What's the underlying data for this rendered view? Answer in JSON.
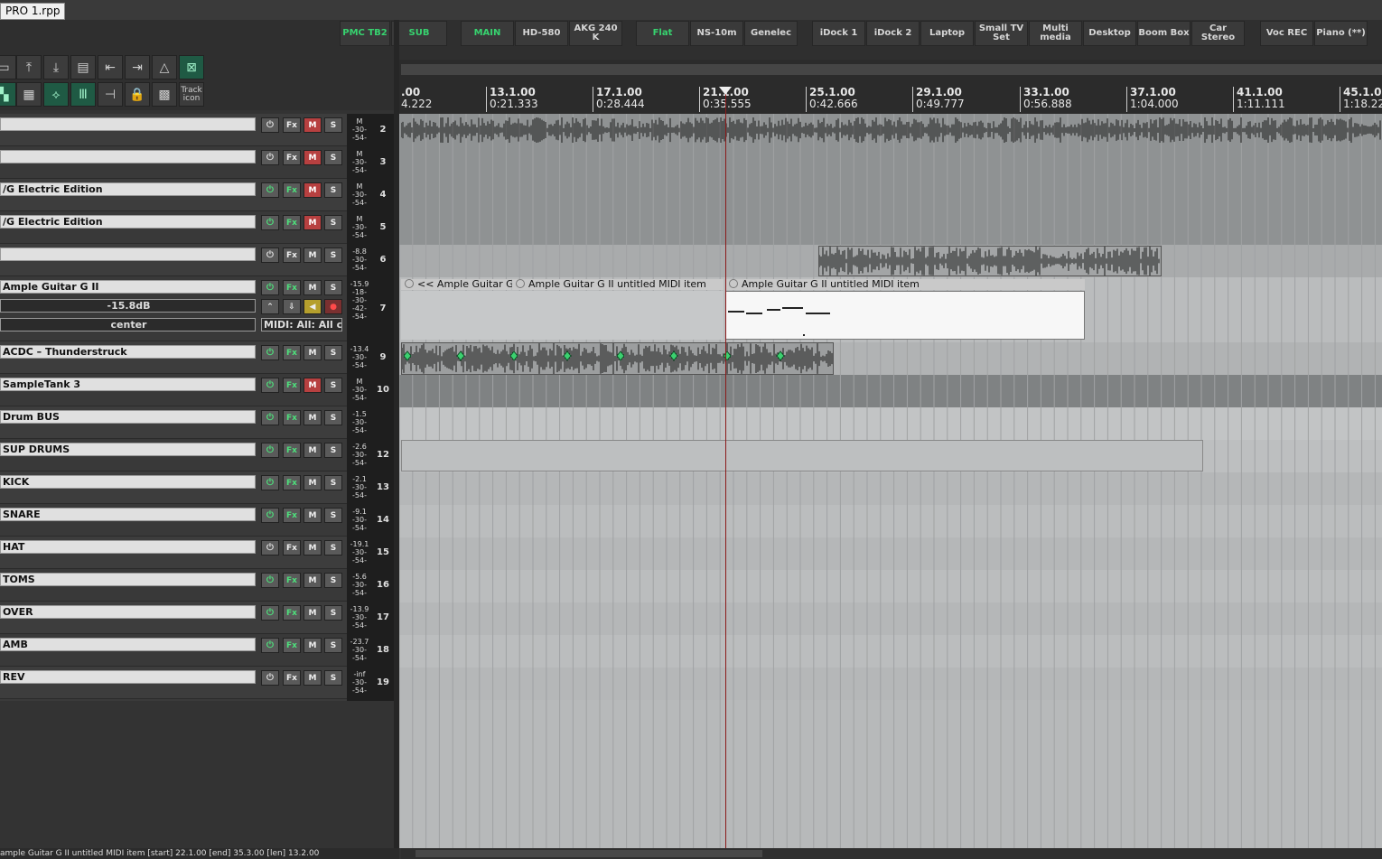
{
  "window": {
    "file_tab": "PRO 1.rpp"
  },
  "view_buttons": [
    {
      "label": "PMC TB2",
      "active": true
    },
    {
      "label": "SUB",
      "active": true
    },
    {
      "label": "MAIN",
      "active": true
    },
    {
      "label": "HD-580",
      "active": false
    },
    {
      "label": "AKG 240 K",
      "active": false
    },
    {
      "label": "Flat",
      "active": true
    },
    {
      "label": "NS-10m",
      "active": false
    },
    {
      "label": "Genelec",
      "active": false
    },
    {
      "label": "iDock 1",
      "active": false
    },
    {
      "label": "iDock 2",
      "active": false
    },
    {
      "label": "Laptop",
      "active": false
    },
    {
      "label": "Small TV Set",
      "active": false
    },
    {
      "label": "Multi media",
      "active": false
    },
    {
      "label": "Desktop",
      "active": false
    },
    {
      "label": "Boom Box",
      "active": false
    },
    {
      "label": "Car Stereo",
      "active": false
    },
    {
      "label": "Voc REC",
      "active": false
    },
    {
      "label": "Piano (**)",
      "active": false
    }
  ],
  "toolbar": {
    "track_icon_label": "Track icon"
  },
  "ruler": [
    {
      "bar": ".00",
      "time": "4.222"
    },
    {
      "bar": "13.1.00",
      "time": "0:21.333"
    },
    {
      "bar": "17.1.00",
      "time": "0:28.444"
    },
    {
      "bar": "21.1.00",
      "time": "0:35.555"
    },
    {
      "bar": "25.1.00",
      "time": "0:42.666"
    },
    {
      "bar": "29.1.00",
      "time": "0:49.777"
    },
    {
      "bar": "33.1.00",
      "time": "0:56.888"
    },
    {
      "bar": "37.1.00",
      "time": "1:04.000"
    },
    {
      "bar": "41.1.00",
      "time": "1:11.111"
    },
    {
      "bar": "45.1.00",
      "time": "1:18.22"
    }
  ],
  "track_buttons": {
    "fx": "Fx",
    "mute": "M",
    "solo": "S"
  },
  "tracks": [
    {
      "num": "2",
      "name": "",
      "meter": [
        "M",
        "-30-",
        "-54-"
      ],
      "fx_on": false,
      "mute_on": true,
      "power_on": false
    },
    {
      "num": "3",
      "name": "",
      "meter": [
        "M",
        "-30-",
        "-54-"
      ],
      "fx_on": false,
      "mute_on": true,
      "power_on": false
    },
    {
      "num": "4",
      "name": "/G Electric Edition",
      "meter": [
        "M",
        "-30-",
        "-54-"
      ],
      "fx_on": true,
      "mute_on": true,
      "power_on": true
    },
    {
      "num": "5",
      "name": "/G Electric Edition",
      "meter": [
        "M",
        "-30-",
        "-54-"
      ],
      "fx_on": true,
      "mute_on": true,
      "power_on": true
    },
    {
      "num": "6",
      "name": "",
      "meter": [
        "-8.8",
        "-30-",
        "-54-"
      ],
      "fx_on": false,
      "mute_on": false,
      "power_on": false
    },
    {
      "num": "7",
      "name": "Ample Guitar G II",
      "meter": [
        "-15.9",
        "-18-",
        "-30-",
        "-42-",
        "-54-"
      ],
      "fx_on": true,
      "mute_on": false,
      "power_on": true,
      "volume": "-15.8dB",
      "pan": "center",
      "midi_input": "MIDI: All: All c"
    },
    {
      "num": "9",
      "name": "ACDC – Thunderstruck",
      "meter": [
        "-13.4",
        "-30-",
        "-54-"
      ],
      "fx_on": true,
      "mute_on": false,
      "power_on": true
    },
    {
      "num": "10",
      "name": "SampleTank 3",
      "meter": [
        "M",
        "-30-",
        "-54-"
      ],
      "fx_on": true,
      "mute_on": true,
      "power_on": true
    },
    {
      "num": "",
      "name": "Drum BUS",
      "meter": [
        "-1.5",
        "-30-",
        "-54-"
      ],
      "fx_on": true,
      "mute_on": false,
      "power_on": true
    },
    {
      "num": "12",
      "name": "SUP DRUMS",
      "meter": [
        "-2.6",
        "-30-",
        "-54-"
      ],
      "fx_on": true,
      "mute_on": false,
      "power_on": true
    },
    {
      "num": "13",
      "name": "KICK",
      "meter": [
        "-2.1",
        "-30-",
        "-54-"
      ],
      "fx_on": true,
      "mute_on": false,
      "power_on": true
    },
    {
      "num": "14",
      "name": "SNARE",
      "meter": [
        "-9.1",
        "-30-",
        "-54-"
      ],
      "fx_on": true,
      "mute_on": false,
      "power_on": true
    },
    {
      "num": "15",
      "name": "HAT",
      "meter": [
        "-19.1",
        "-30-",
        "-54-"
      ],
      "fx_on": false,
      "mute_on": false,
      "power_on": false
    },
    {
      "num": "16",
      "name": "TOMS",
      "meter": [
        "-5.6",
        "-30-",
        "-54-"
      ],
      "fx_on": true,
      "mute_on": false,
      "power_on": true
    },
    {
      "num": "17",
      "name": "OVER",
      "meter": [
        "-13.9",
        "-30-",
        "-54-"
      ],
      "fx_on": true,
      "mute_on": false,
      "power_on": true
    },
    {
      "num": "18",
      "name": "AMB",
      "meter": [
        "-23.7",
        "-30-",
        "-54-"
      ],
      "fx_on": true,
      "mute_on": false,
      "power_on": true
    },
    {
      "num": "19",
      "name": "REV",
      "meter": [
        "-inf",
        "-30-",
        "-54-"
      ],
      "fx_on": false,
      "mute_on": false,
      "power_on": false
    }
  ],
  "items": {
    "midi1": "<< Ample Guitar G I...",
    "midi2": "Ample Guitar G II untitled MIDI item",
    "midi3": "Ample Guitar G II untitled MIDI item"
  },
  "status": "ample Guitar G II untitled MIDI item [start] 22.1.00 [end] 35.3.00 [len] 13.2.00"
}
